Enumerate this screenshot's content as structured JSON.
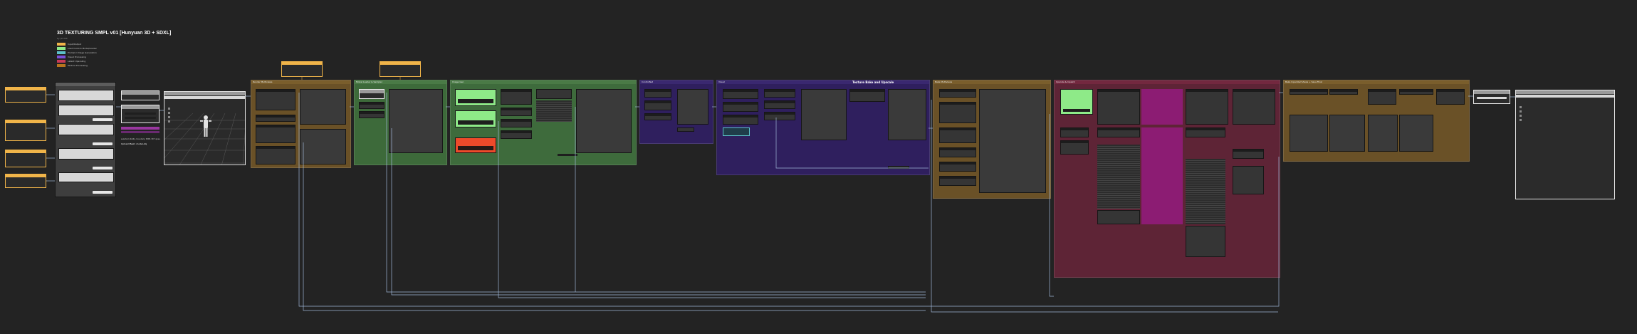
{
  "workflow": {
    "title": "3D TEXTURING SMPL v01 [Hunyuan 3D + SDXL]",
    "subtitle": "by phr00t",
    "legend": [
      {
        "label": "Input/Output",
        "color": "#f0b449"
      },
      {
        "label": "Load Custom Model/Loader",
        "color": "#8eea88"
      },
      {
        "label": "Prompt / Image Generation",
        "color": "#5bc0c8"
      },
      {
        "label": "Visual Processing",
        "color": "#7a4fd8"
      },
      {
        "label": "Latent Upscaling",
        "color": "#c83a58"
      },
      {
        "label": "Texture Processing",
        "color": "#b8741e"
      }
    ]
  },
  "groups": [
    {
      "id": "render-views",
      "label": "Render Multiviews",
      "color": "#6a5127"
    },
    {
      "id": "model-loader",
      "label": "Model Loader & Sampler",
      "color": "#3d6a3a"
    },
    {
      "id": "image-gen",
      "label": "Image Gen",
      "color": "#3e6b3c"
    },
    {
      "id": "controlnet",
      "label": "ControlNet",
      "color": "#2f1f5e"
    },
    {
      "id": "visual-processing",
      "label": "Visual",
      "color": "#2f1f5e"
    },
    {
      "id": "bake-views",
      "label": "Bake Multiviews",
      "color": "#6a5127"
    },
    {
      "id": "upscale",
      "label": "Upscale & Inpaint",
      "color": "#5e2436"
    },
    {
      "id": "texture-finalize",
      "label": "Bake Inpainted Views + Save Final",
      "color": "#6a5127"
    }
  ],
  "labels": {
    "group_heading": "Texture Bake and Upscale",
    "viewer_caption": "Upload Mesh: model.obj",
    "mesh_note": "selected vitality, boundary: SMPL 3D T-pose"
  },
  "colors": {
    "background": "#232323",
    "accent": "#f0b449",
    "wire": "#9fb5d6"
  }
}
